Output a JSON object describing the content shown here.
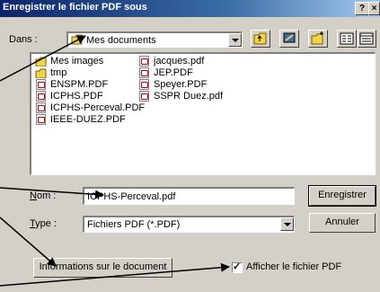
{
  "dialog": {
    "title": "Enregistrer le fichier PDF sous",
    "help_button": "?",
    "close_button": "×"
  },
  "location": {
    "label": "Dans :",
    "value": "Mes documents"
  },
  "toolbar": {
    "icons": [
      "up-folder-icon",
      "desktop-icon",
      "new-folder-icon",
      "list-view-icon",
      "details-view-icon"
    ]
  },
  "files": {
    "column1": [
      {
        "name": "Mes images",
        "type": "folder"
      },
      {
        "name": "tmp",
        "type": "folder"
      },
      {
        "name": "ENSPM.PDF",
        "type": "pdf"
      },
      {
        "name": "ICPHS.PDF",
        "type": "pdf"
      },
      {
        "name": "ICPHS-Perceval.PDF",
        "type": "pdf"
      },
      {
        "name": "IEEE-DUEZ.PDF",
        "type": "pdf"
      }
    ],
    "column2": [
      {
        "name": "jacques.pdf",
        "type": "pdf"
      },
      {
        "name": "JEP.PDF",
        "type": "pdf"
      },
      {
        "name": "Speyer.PDF",
        "type": "pdf"
      },
      {
        "name": "SSPR Duez.pdf",
        "type": "pdf"
      }
    ]
  },
  "filename": {
    "label": "Nom :",
    "value": "ICPHS-Perceval.pdf"
  },
  "filetype": {
    "label": "Type :",
    "value": "Fichiers PDF (*.PDF)"
  },
  "buttons": {
    "save": "Enregistrer",
    "cancel": "Annuler",
    "doc_info": "Informations sur le document"
  },
  "show_pdf": {
    "label": "Afficher le fichier PDF",
    "checked": true,
    "mark": "✓"
  },
  "colors": {
    "title_bar": "#0a246a",
    "dialog_bg": "#d4d0c8",
    "folder": "#f2d34a",
    "arrow": "#000000"
  }
}
